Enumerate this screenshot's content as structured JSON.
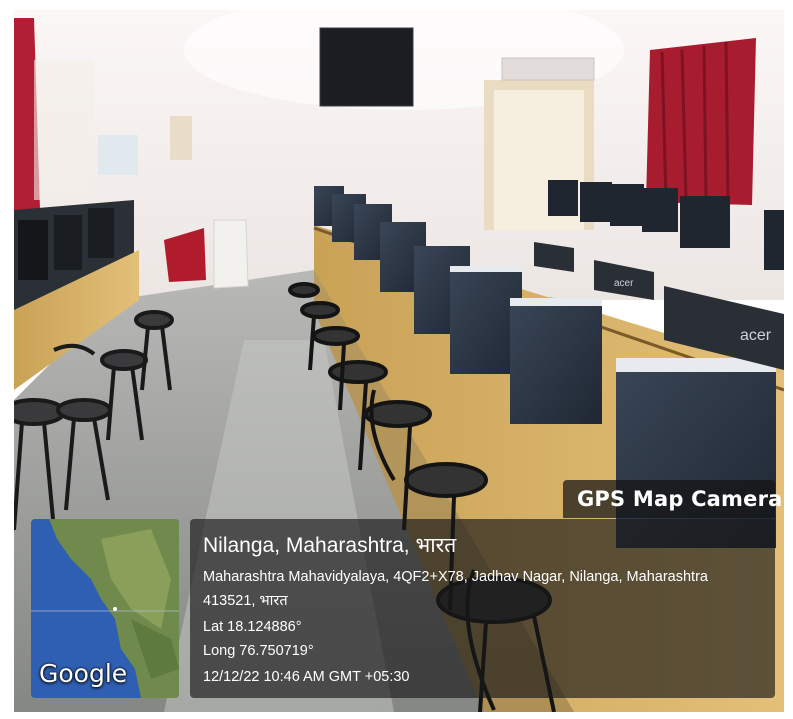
{
  "overlay": {
    "app_label": "GPS Map Camera",
    "map_provider": "Google",
    "location_title": "Nilanga, Maharashtra, भारत",
    "address": "Maharashtra Mahavidyalaya, 4QF2+X78, Jadhav Nagar, Nilanga, Maharashtra 413521, भारत",
    "latitude": "Lat 18.124886°",
    "longitude": "Long 76.750719°",
    "timestamp": "12/12/22 10:46 AM GMT +05:30"
  },
  "scene": {
    "monitor_brand": "acer"
  },
  "colors": {
    "wall": "#f4f0ee",
    "curtain": "#b01f34",
    "floor": "#9a9c9a",
    "desk_wood": "#d9b36a",
    "panel_bg": "#1a1a1a",
    "map_water": "#2f5fb2",
    "map_land": "#6f8a4c"
  }
}
